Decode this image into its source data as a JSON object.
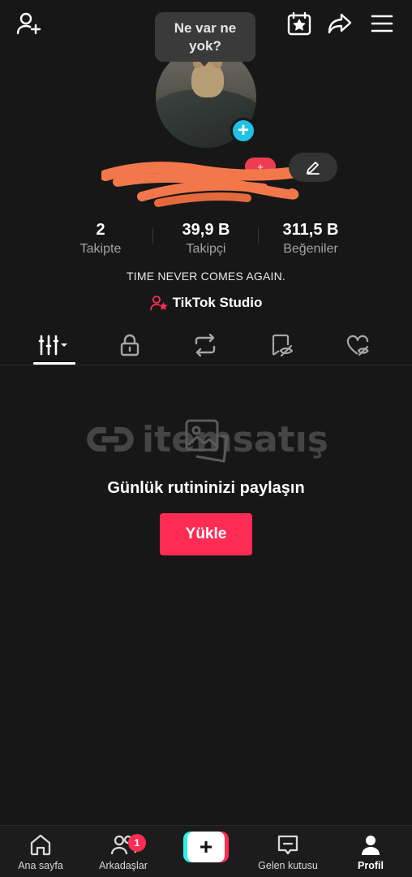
{
  "topbar": {
    "icons": [
      "add-user-icon",
      "calendar-star-icon",
      "share-icon",
      "menu-icon"
    ]
  },
  "profile": {
    "status_bubble": "Ne var ne yok?",
    "verified_pill": "+"
  },
  "stats": [
    {
      "value": "2",
      "label": "Takipte"
    },
    {
      "value": "39,9 B",
      "label": "Takipçi"
    },
    {
      "value": "311,5 B",
      "label": "Beğeniler"
    }
  ],
  "bio": "TIME NEVER COMES AGAIN.",
  "studio": {
    "label": "TikTok Studio"
  },
  "tabs": [
    "grid-icon",
    "lock-icon",
    "repost-icon",
    "hidden-icon",
    "liked-icon"
  ],
  "empty_state": {
    "watermark": "itemsatış",
    "title": "Günlük rutininizi paylaşın",
    "button": "Yükle"
  },
  "bottom_nav": {
    "items": [
      {
        "label": "Ana sayfa"
      },
      {
        "label": "Arkadaşlar",
        "badge": "1"
      },
      {
        "label": "Gelen kutusu"
      },
      {
        "label": "Profil"
      }
    ]
  },
  "colors": {
    "background": "#171717",
    "accent": "#fe2c55",
    "cyan": "#25f4ee",
    "avatar_badge": "#20c1e4"
  }
}
